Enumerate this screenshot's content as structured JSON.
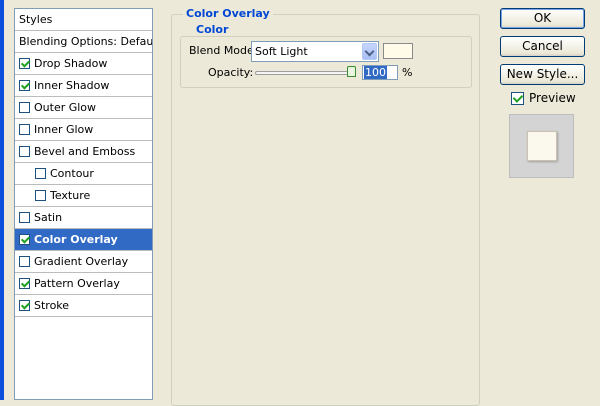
{
  "styles_panel": {
    "header": "Styles",
    "blending_options": "Blending Options: Default",
    "items": [
      {
        "label": "Drop Shadow",
        "checked": true,
        "sub": false,
        "selected": false
      },
      {
        "label": "Inner Shadow",
        "checked": true,
        "sub": false,
        "selected": false
      },
      {
        "label": "Outer Glow",
        "checked": false,
        "sub": false,
        "selected": false
      },
      {
        "label": "Inner Glow",
        "checked": false,
        "sub": false,
        "selected": false
      },
      {
        "label": "Bevel and Emboss",
        "checked": false,
        "sub": false,
        "selected": false
      },
      {
        "label": "Contour",
        "checked": false,
        "sub": true,
        "selected": false
      },
      {
        "label": "Texture",
        "checked": false,
        "sub": true,
        "selected": false
      },
      {
        "label": "Satin",
        "checked": false,
        "sub": false,
        "selected": false
      },
      {
        "label": "Color Overlay",
        "checked": true,
        "sub": false,
        "selected": true
      },
      {
        "label": "Gradient Overlay",
        "checked": false,
        "sub": false,
        "selected": false
      },
      {
        "label": "Pattern Overlay",
        "checked": true,
        "sub": false,
        "selected": false
      },
      {
        "label": "Stroke",
        "checked": true,
        "sub": false,
        "selected": false
      }
    ]
  },
  "color_overlay": {
    "title": "Color Overlay",
    "color_group_title": "Color",
    "blend_mode_label": "Blend Mode:",
    "blend_mode_value": "Soft Light",
    "overlay_color": "#fffbe8",
    "opacity_label": "Opacity:",
    "opacity_value": "100",
    "opacity_unit": "%"
  },
  "buttons": {
    "ok": "OK",
    "cancel": "Cancel",
    "new_style": "New Style..."
  },
  "preview": {
    "label": "Preview",
    "checked": true,
    "swatch_color": "#fbf8ee"
  }
}
